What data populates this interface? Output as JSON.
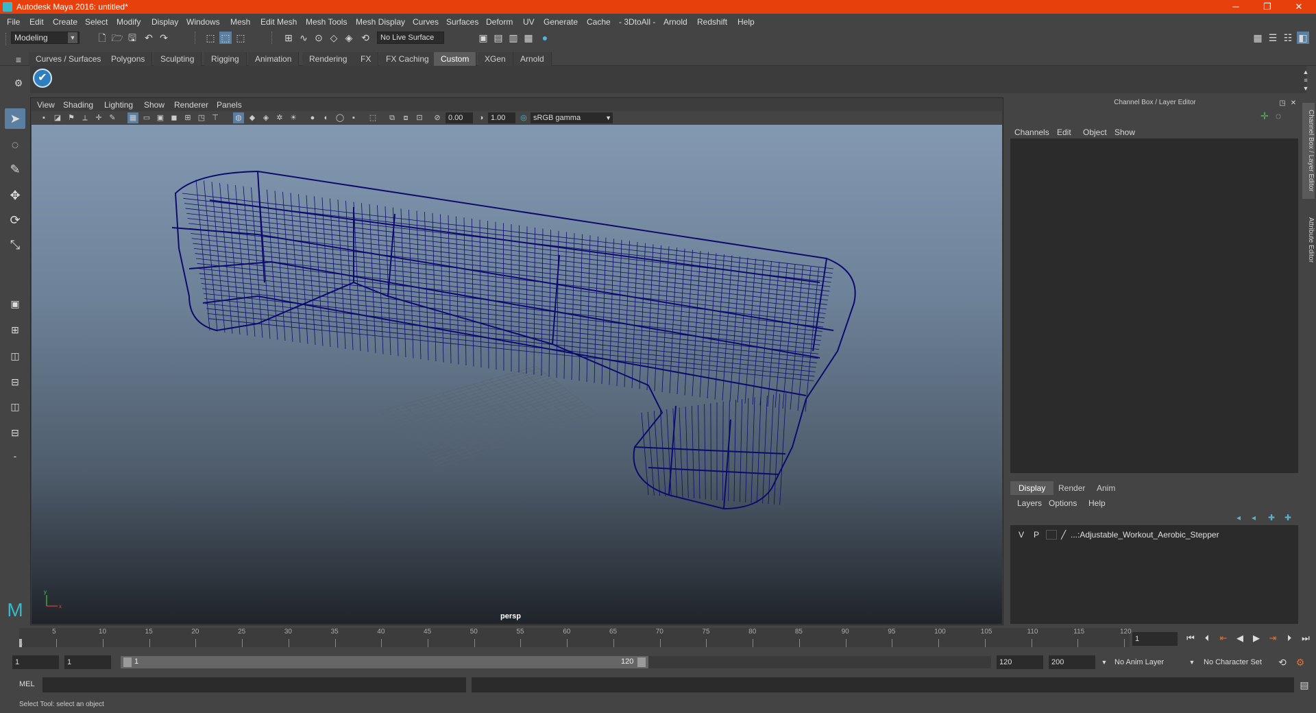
{
  "window": {
    "title": "Autodesk Maya 2016: untitled*",
    "minimize": "─",
    "restore": "❐",
    "close": "✕"
  },
  "menus": [
    "File",
    "Edit",
    "Create",
    "Select",
    "Modify",
    "Display",
    "Windows",
    "Mesh",
    "Edit Mesh",
    "Mesh Tools",
    "Mesh Display",
    "Curves",
    "Surfaces",
    "Deform",
    "UV",
    "Generate",
    "Cache",
    "- 3DtoAll -",
    "Arnold",
    "Redshift",
    "Help"
  ],
  "status_line": {
    "mode": "Modeling",
    "live_surface": "No Live Surface"
  },
  "shelf_tabs": [
    "Curves / Surfaces",
    "Polygons",
    "Sculpting",
    "Rigging",
    "Animation",
    "Rendering",
    "FX",
    "FX Caching",
    "Custom",
    "XGen",
    "Arnold"
  ],
  "shelf_active_tab": "Custom",
  "viewport": {
    "menus": [
      "View",
      "Shading",
      "Lighting",
      "Show",
      "Renderer",
      "Panels"
    ],
    "exposure": "0.00",
    "gamma": "1.00",
    "color_space": "sRGB gamma",
    "camera_label": "persp",
    "wire_color": "#0b0b6e"
  },
  "channel_box": {
    "title": "Channel Box / Layer Editor",
    "menus": [
      "Channels",
      "Edit",
      "Object",
      "Show"
    ]
  },
  "layer_editor": {
    "tabs": [
      "Display",
      "Render",
      "Anim"
    ],
    "active_tab": "Display",
    "menus": [
      "Layers",
      "Options",
      "Help"
    ],
    "layer": {
      "visible": "V",
      "playback": "P",
      "name": "...:Adjustable_Workout_Aerobic_Stepper"
    }
  },
  "side_tabs": [
    "Channel Box / Layer Editor",
    "Attribute Editor"
  ],
  "time_slider": {
    "ticks": [
      "5",
      "10",
      "15",
      "20",
      "25",
      "30",
      "35",
      "40",
      "45",
      "50",
      "55",
      "60",
      "65",
      "70",
      "75",
      "80",
      "85",
      "90",
      "95",
      "100",
      "105",
      "110",
      "115",
      "120"
    ],
    "start_marker": "1",
    "current_frame": "1"
  },
  "range_slider": {
    "start": "1",
    "playback_start": "1",
    "range_start_label": "1",
    "range_end_label": "120",
    "playback_end": "120",
    "end": "200",
    "anim_layer": "No Anim Layer",
    "character_set": "No Character Set"
  },
  "command_line": {
    "label": "MEL"
  },
  "help_line": {
    "text": "Select Tool: select an object"
  }
}
